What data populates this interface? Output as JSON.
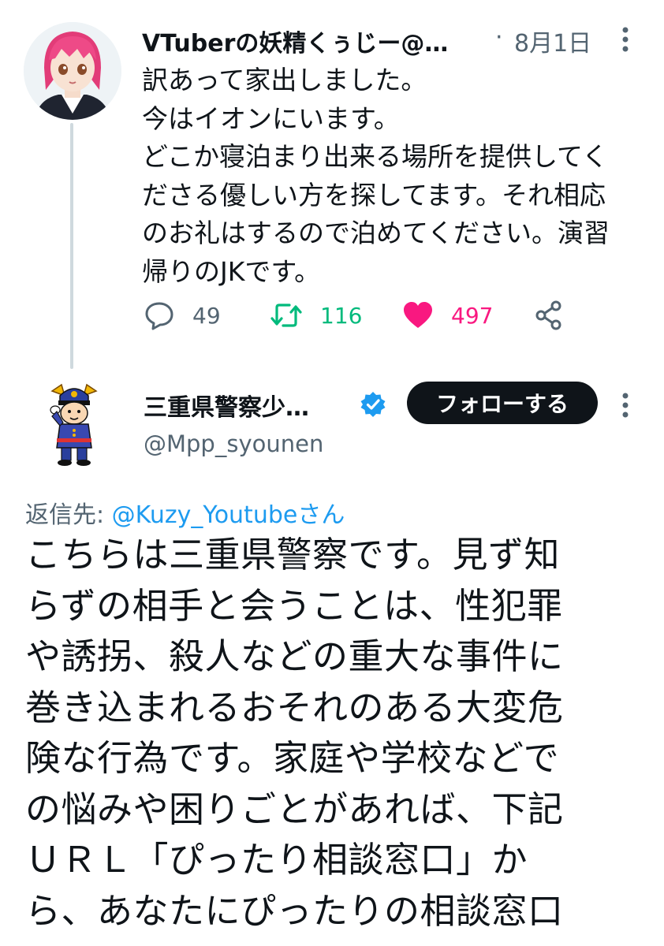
{
  "tweet1": {
    "author_name": "VTuberの妖精くぅじー@…",
    "separator": "·",
    "date": "8月1日",
    "text": "訳あって家出しました。\n今はイオンにいます。\nどこか寝泊まり出来る場所を提供してく\nださる優しい方を探してます。それ相応\nのお礼はするので泊めてください。演習\n帰りのJKです。",
    "actions": {
      "reply_icon": "reply-icon",
      "reply_count": "49",
      "retweet_icon": "retweet-icon",
      "retweet_count": "116",
      "like_icon": "heart-icon",
      "like_count": "497",
      "share_icon": "share-icon"
    }
  },
  "tweet2": {
    "author_name": "三重県警察少…",
    "verified_icon": "verified-badge-icon",
    "follow_label": "フォローする",
    "handle": "@Mpp_syounen",
    "reply_prefix": "返信先: ",
    "reply_mention": "@Kuzy_Youtubeさん",
    "text": "こちらは三重県警察です。見ず知\nらずの相手と会うことは、性犯罪\nや誘拐、殺人などの重大な事件に\n巻き込まれるおそれのある大変危\n険な行為です。家庭や学校などで\nの悩みや困りごとがあれば、下記\nＵＲＬ「ぴったり相談窓口」か\nら、あなたにぴったりの相談窓口"
  },
  "colors": {
    "text": "#0f1419",
    "secondary": "#536471",
    "link": "#1d9bf0",
    "retweet": "#00ba7c",
    "like": "#f91880",
    "follow_button_bg": "#0f1419",
    "thread_line": "#cfd9de"
  }
}
